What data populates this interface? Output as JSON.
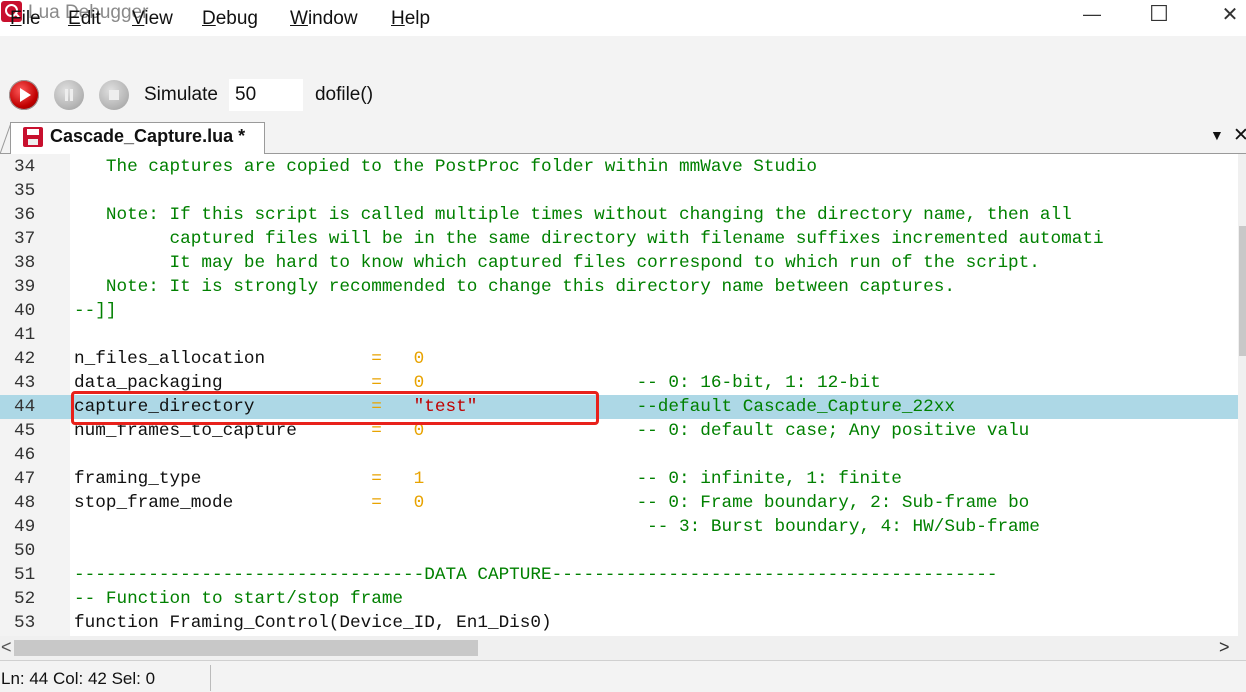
{
  "window": {
    "title": "Lua Debugger",
    "minimize_glyph": "—",
    "maximize_glyph": "☐",
    "close_glyph": "✕"
  },
  "menu": [
    {
      "u": "F",
      "rest": "ile"
    },
    {
      "u": "E",
      "rest": "dit"
    },
    {
      "u": "V",
      "rest": "iew"
    },
    {
      "u": "D",
      "rest": "ebug"
    },
    {
      "u": "W",
      "rest": "indow"
    },
    {
      "u": "H",
      "rest": "elp"
    }
  ],
  "toolbar": {
    "simulate_label": "Simulate",
    "simulate_value": "50",
    "dofile_label": "dofile()"
  },
  "tab": {
    "label": "Cascade_Capture.lua *",
    "dropdown_glyph": "▼",
    "close_glyph": "✕"
  },
  "editor": {
    "lines": [
      {
        "n": "34",
        "segs": [
          {
            "t": "   The captures are copied to the PostProc folder within mmWave Studio",
            "c": "c-comment"
          }
        ]
      },
      {
        "n": "35",
        "segs": []
      },
      {
        "n": "36",
        "segs": [
          {
            "t": "   Note: If this script is called multiple times without changing the directory name, then all",
            "c": "c-comment"
          }
        ]
      },
      {
        "n": "37",
        "segs": [
          {
            "t": "         captured files will be in the same directory with filename suffixes incremented automati",
            "c": "c-comment"
          }
        ]
      },
      {
        "n": "38",
        "segs": [
          {
            "t": "         It may be hard to know which captured files correspond to which run of the script.",
            "c": "c-comment"
          }
        ]
      },
      {
        "n": "39",
        "segs": [
          {
            "t": "   Note: It is strongly recommended to change this directory name between captures.",
            "c": "c-comment"
          }
        ]
      },
      {
        "n": "40",
        "segs": [
          {
            "t": "--]]",
            "c": "c-comment"
          }
        ]
      },
      {
        "n": "41",
        "segs": []
      },
      {
        "n": "42",
        "segs": [
          {
            "t": "n_files_allocation          ",
            "c": "c-plain"
          },
          {
            "t": "=   0",
            "c": "c-num"
          }
        ]
      },
      {
        "n": "43",
        "segs": [
          {
            "t": "data_packaging              ",
            "c": "c-plain"
          },
          {
            "t": "=   0",
            "c": "c-num"
          },
          {
            "t": "                    -- 0: 16-bit, 1: 12-bit",
            "c": "c-comment"
          }
        ]
      },
      {
        "n": "44",
        "segs": [
          {
            "t": "capture_directory           ",
            "c": "c-plain"
          },
          {
            "t": "=   ",
            "c": "c-op"
          },
          {
            "t": "\"test\"",
            "c": "c-str"
          },
          {
            "t": "               --default Cascade_Capture_22xx",
            "c": "c-comment"
          }
        ],
        "hl": true
      },
      {
        "n": "45",
        "segs": [
          {
            "t": "num_frames_to_capture       ",
            "c": "c-plain"
          },
          {
            "t": "=   0",
            "c": "c-num"
          },
          {
            "t": "                    -- 0: default case; Any positive valu",
            "c": "c-comment"
          }
        ]
      },
      {
        "n": "46",
        "segs": []
      },
      {
        "n": "47",
        "segs": [
          {
            "t": "framing_type                ",
            "c": "c-plain"
          },
          {
            "t": "=   1",
            "c": "c-num"
          },
          {
            "t": "                    -- 0: infinite, 1: finite",
            "c": "c-comment"
          }
        ]
      },
      {
        "n": "48",
        "segs": [
          {
            "t": "stop_frame_mode             ",
            "c": "c-plain"
          },
          {
            "t": "=   0",
            "c": "c-num"
          },
          {
            "t": "                    -- 0: Frame boundary, 2: Sub-frame bo",
            "c": "c-comment"
          }
        ]
      },
      {
        "n": "49",
        "segs": [
          {
            "t": "                                                      -- 3: Burst boundary, 4: HW/Sub-frame",
            "c": "c-comment"
          }
        ]
      },
      {
        "n": "50",
        "segs": []
      },
      {
        "n": "51",
        "segs": [
          {
            "t": "---------------------------------DATA CAPTURE------------------------------------------",
            "c": "c-comment"
          }
        ]
      },
      {
        "n": "52",
        "segs": [
          {
            "t": "-- Function to start/stop frame",
            "c": "c-comment"
          }
        ]
      },
      {
        "n": "53",
        "segs": [
          {
            "t": "function Framing_Control(Device_ID, En1_Dis0)",
            "c": "c-plain"
          }
        ]
      }
    ]
  },
  "scroll": {
    "left_arrow": "<",
    "right_arrow": ">"
  },
  "status": {
    "text": "Ln: 44  Col: 42  Sel: 0"
  }
}
